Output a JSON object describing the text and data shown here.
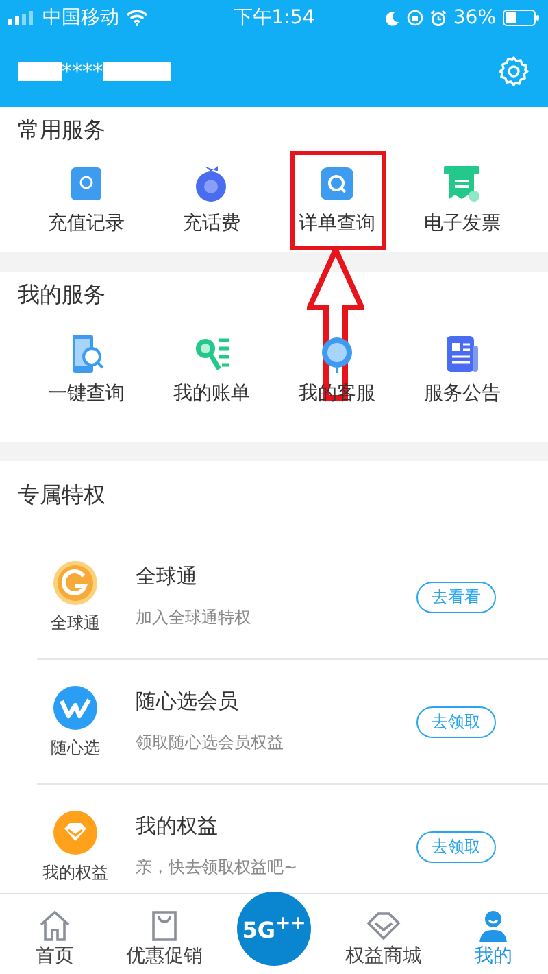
{
  "status_bar": {
    "carrier": "中国移动",
    "time": "下午1:54",
    "battery": "36%"
  },
  "header": {
    "account": "****"
  },
  "sections": [
    {
      "title": "常用服务",
      "items": [
        {
          "label": "充值记录",
          "kind": "record",
          "highlighted": false
        },
        {
          "label": "充话费",
          "kind": "charge",
          "highlighted": false
        },
        {
          "label": "详单查询",
          "kind": "detail",
          "highlighted": true
        },
        {
          "label": "电子发票",
          "kind": "invoice",
          "highlighted": false
        }
      ]
    },
    {
      "title": "我的服务",
      "items": [
        {
          "label": "一键查询",
          "kind": "phone",
          "highlighted": false
        },
        {
          "label": "我的账单",
          "kind": "bill",
          "highlighted": false
        },
        {
          "label": "我的客服",
          "kind": "service",
          "highlighted": false
        },
        {
          "label": "服务公告",
          "kind": "notice",
          "highlighted": false
        }
      ]
    }
  ],
  "privileges": {
    "title": "专属特权",
    "rows": [
      {
        "kind": "globe",
        "icon_label": "全球通",
        "title": "全球通",
        "subtitle": "加入全球通特权",
        "button": "去看看"
      },
      {
        "kind": "choice",
        "icon_label": "随心选",
        "title": "随心选会员",
        "subtitle": "领取随心选会员权益",
        "button": "去领取"
      },
      {
        "kind": "gem",
        "icon_label": "我的权益",
        "title": "我的权益",
        "subtitle": "亲，快去领取权益吧~",
        "button": "去领取"
      }
    ]
  },
  "tab_bar": [
    {
      "kind": "home",
      "label": "首页",
      "selected": false
    },
    {
      "kind": "bag",
      "label": "优惠促销",
      "selected": false
    },
    {
      "kind": "logo",
      "label": "5G$^{++}$",
      "selected": false
    },
    {
      "kind": "diamond",
      "label": "权益商城",
      "selected": false
    },
    {
      "kind": "user",
      "label": "我的",
      "selected": true
    }
  ]
}
